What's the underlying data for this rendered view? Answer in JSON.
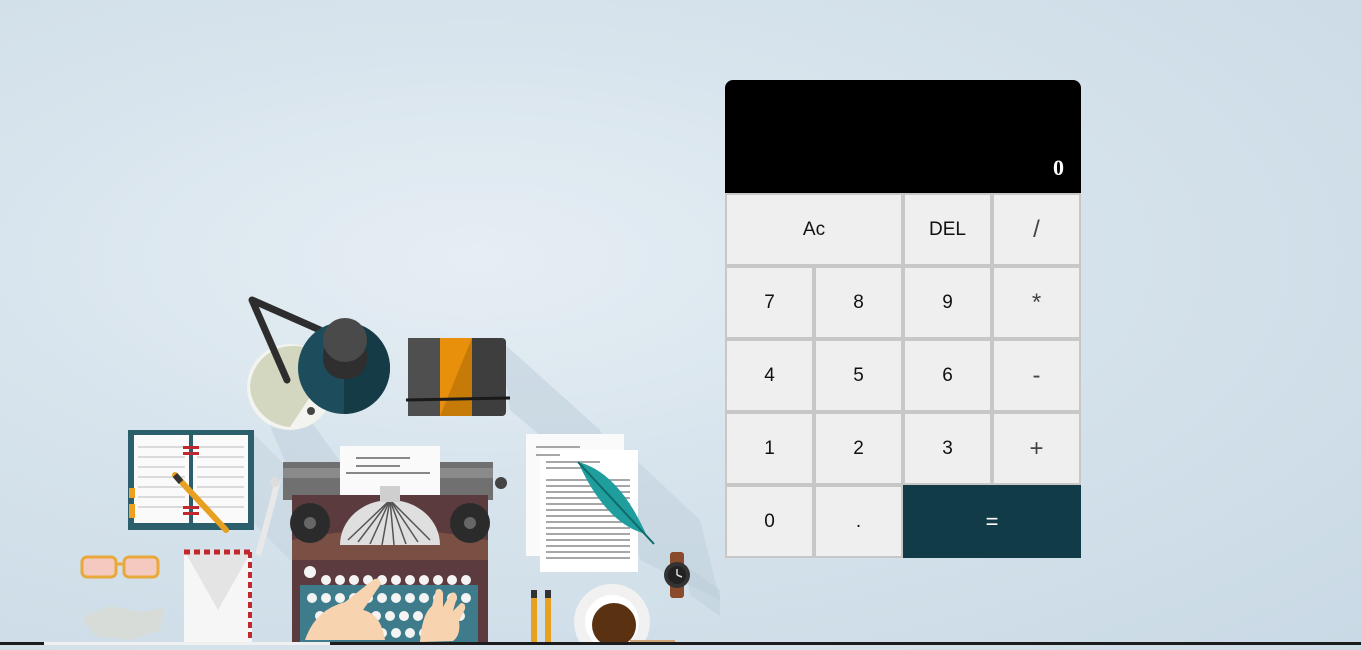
{
  "calculator": {
    "display_value": "0",
    "keys": {
      "all_clear": "Ac",
      "delete": "DEL",
      "divide": "/",
      "seven": "7",
      "eight": "8",
      "nine": "9",
      "multiply": "*",
      "four": "4",
      "five": "5",
      "six": "6",
      "subtract": "-",
      "one": "1",
      "two": "2",
      "three": "3",
      "add": "+",
      "zero": "0",
      "decimal": ".",
      "equals": "="
    },
    "colors": {
      "screen": "#000000",
      "key": "#efefef",
      "equals": "#123b48"
    }
  },
  "illustration": {
    "items": [
      "desk-lamp-icon",
      "notebook-icon",
      "typewriter-icon",
      "papers-icon",
      "feather-quill-icon",
      "wristwatch-icon",
      "coffee-cup-icon",
      "glasses-icon",
      "envelope-icon",
      "pens-icon",
      "crumpled-paper-icon",
      "book-icon"
    ]
  }
}
